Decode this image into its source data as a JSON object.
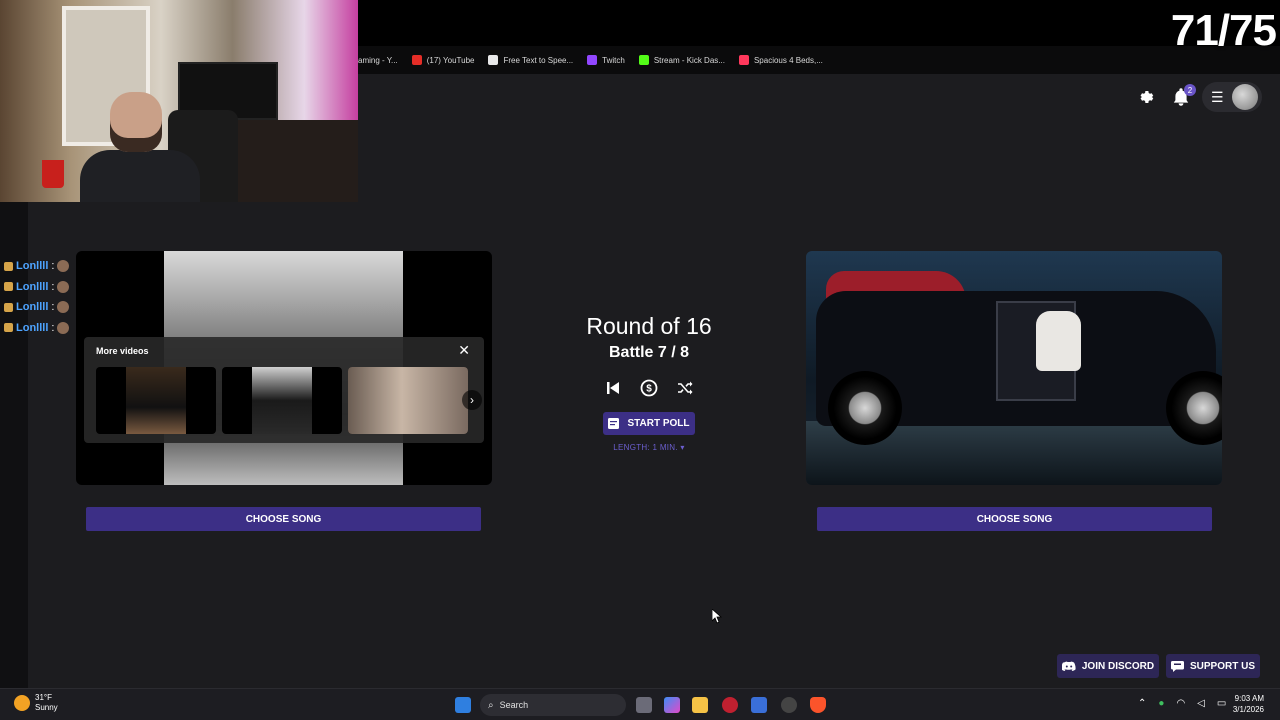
{
  "stream": {
    "counter": "71/75",
    "chat": [
      {
        "user": "Lonllll",
        "sep": ":"
      },
      {
        "user": "Lonllll",
        "sep": ":"
      },
      {
        "user": "Lonllll",
        "sep": ":"
      },
      {
        "user": "Lonllll",
        "sep": ":"
      }
    ]
  },
  "bookmarks": [
    {
      "label": "aming - Y...",
      "color": "#444"
    },
    {
      "label": "(17) YouTube",
      "color": "#e52d27"
    },
    {
      "label": "Free Text to Spee...",
      "color": "#e8e8e8"
    },
    {
      "label": "Twitch",
      "color": "#9146ff"
    },
    {
      "label": "Stream - Kick Das...",
      "color": "#53fc18"
    },
    {
      "label": "Spacious 4 Beds,...",
      "color": "#ff385c"
    }
  ],
  "header": {
    "notifications_count": "2",
    "settings_icon": "gear-icon",
    "bell_icon": "bell-icon",
    "menu_icon": "hamburger-icon"
  },
  "battle": {
    "round_title": "Round of 16",
    "battle_label": "Battle 7 / 8",
    "start_poll_label": "START POLL",
    "length_label": "LENGTH: 1 MIN. ▾",
    "choose_left": "CHOOSE SONG",
    "choose_right": "CHOOSE SONG"
  },
  "more_videos": {
    "title": "More videos",
    "close": "✕",
    "next": "›"
  },
  "footer": {
    "discord_label": "JOIN DISCORD",
    "support_label": "SUPPORT US"
  },
  "taskbar": {
    "weather_temp": "31°F",
    "weather_desc": "Sunny",
    "search_placeholder": "Search",
    "time": "9:03 AM",
    "date": "3/1/2026"
  },
  "colors": {
    "accent": "#3c2f86",
    "link": "#6c5fd0",
    "chat_name": "#4ea4ff"
  }
}
